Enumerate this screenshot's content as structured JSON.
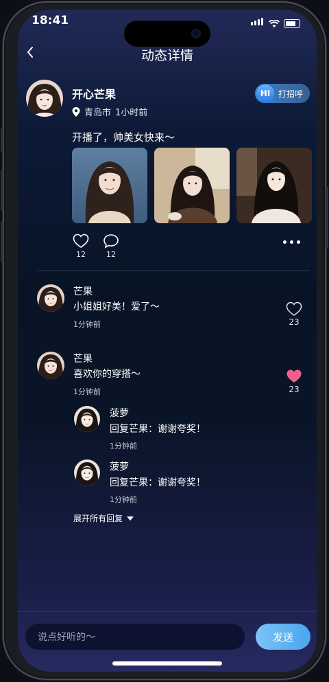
{
  "status_bar": {
    "time": "18:41"
  },
  "header": {
    "back_icon": "chevron-left-icon",
    "title": "动态详情"
  },
  "post": {
    "author": "开心芒果",
    "location": "青岛市",
    "time_ago": "1小时前",
    "greet": {
      "badge": "HI",
      "label": "打招呼"
    },
    "text": "开播了，帅美女快来～",
    "photo_count": 3,
    "likes": "12",
    "comments_count": "12"
  },
  "comments": [
    {
      "name": "芒果",
      "text": "小姐姐好美！爱了～",
      "time": "1分钟前",
      "likes": "23",
      "liked": false
    },
    {
      "name": "芒果",
      "text": "喜欢你的穿搭～",
      "time": "1分钟前",
      "likes": "23",
      "liked": true,
      "replies": [
        {
          "name": "菠萝",
          "text": "回复芒果：谢谢夸奖！",
          "time": "1分钟前"
        },
        {
          "name": "菠萝",
          "text": "回复芒果：谢谢夸奖！",
          "time": "1分钟前"
        }
      ]
    }
  ],
  "expand_label": "展开所有回复",
  "input": {
    "placeholder": "说点好听的～",
    "send_label": "发送"
  },
  "colors": {
    "accent": "#4aa6ee",
    "liked": "#f0608f",
    "background": "#081426"
  }
}
